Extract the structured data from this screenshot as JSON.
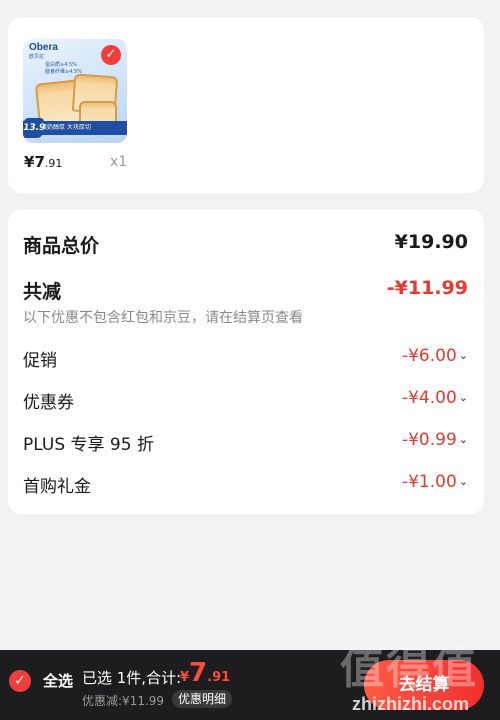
{
  "product": {
    "thumbnail": {
      "brand": "Obera",
      "brand_sub": "欧贝拉",
      "tag_1": "蛋白质≥4.5%",
      "tag_2": "膳食纤维≥4.5%",
      "banner_price": "13.9",
      "banner_text": "蛋奶醇厚  大块厚切",
      "check_icon": "✓"
    },
    "price_currency": "¥",
    "price_int": "7",
    "price_dec": ".91",
    "quantity": "x1"
  },
  "summary": {
    "total_label": "商品总价",
    "total_value": "¥19.90",
    "reduce_label": "共减",
    "reduce_value": "-¥11.99",
    "note": "以下优惠不包含红包和京豆，请在结算页查看",
    "items": [
      {
        "label": "促销",
        "value": "-¥6.00"
      },
      {
        "label": "优惠券",
        "value": "-¥4.00"
      },
      {
        "label": "PLUS 专享 95 折",
        "value": "-¥0.99"
      },
      {
        "label": "首购礼金",
        "value": "-¥1.00"
      }
    ],
    "chevron": "⌄"
  },
  "bottom": {
    "select_all": "全选",
    "selected_text": "已选 1件,合计:",
    "total_currency": "¥",
    "total_int": "7",
    "total_dec": ".91",
    "discount_text": "优惠减:¥11.99",
    "detail_label": "优惠明细",
    "checkout_label": "去结算"
  },
  "watermark": {
    "text": "值得值",
    "url": "zhizhizhi.com"
  },
  "colors": {
    "accent": "#e8382f",
    "bar_bg": "#1d1d1f",
    "page_bg": "#f2f2f2"
  }
}
